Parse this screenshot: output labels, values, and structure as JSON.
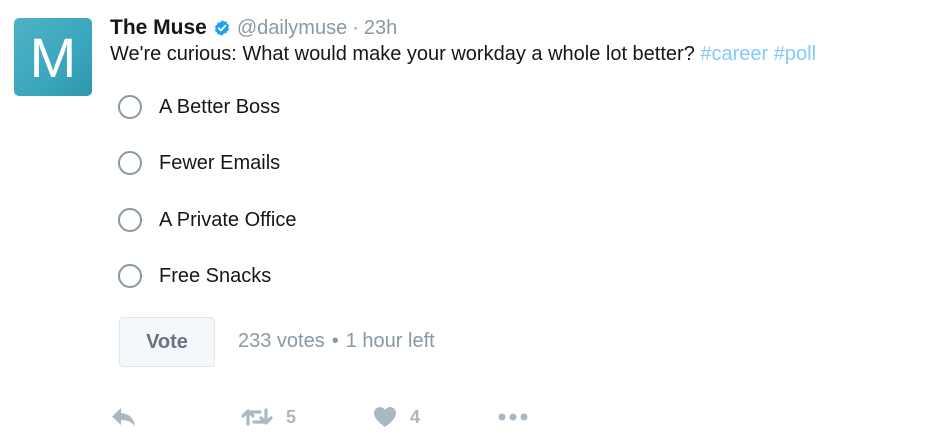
{
  "tweet": {
    "avatar_letter": "M",
    "display_name": "The Muse",
    "handle": "@dailymuse",
    "separator": "·",
    "time": "23h",
    "text": "We're curious: What would make your workday a whole lot better?",
    "hashtags": [
      "#career",
      "#poll"
    ]
  },
  "poll": {
    "options": [
      {
        "label": "A Better Boss"
      },
      {
        "label": "Fewer Emails"
      },
      {
        "label": "A Private Office"
      },
      {
        "label": "Free Snacks"
      }
    ],
    "vote_label": "Vote",
    "votes": "233 votes",
    "dot": "•",
    "time_left": "1 hour left"
  },
  "actions": {
    "retweet_count": "5",
    "like_count": "4"
  },
  "colors": {
    "hashtag": "#88c9f9",
    "verified": "#1da1f2",
    "muted": "#8899a6",
    "icon": "#aab8c2",
    "avatar": "#3aa6bd"
  }
}
